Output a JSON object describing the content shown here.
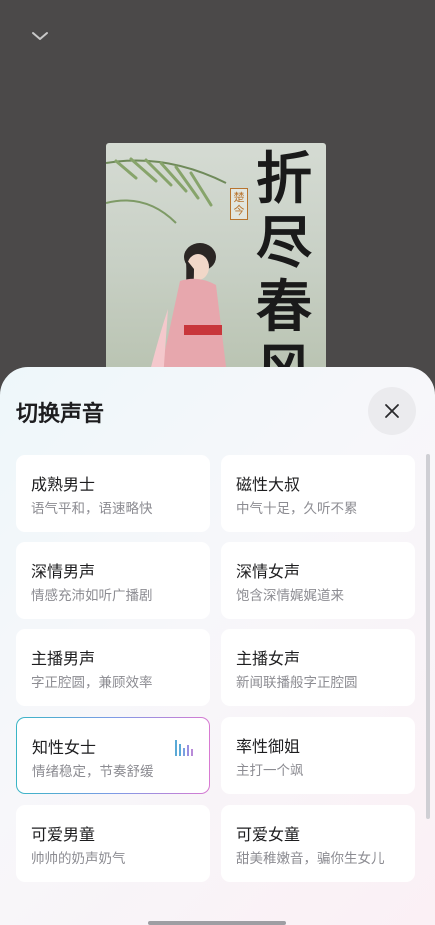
{
  "book": {
    "title": "折尽春风",
    "author": "楚今"
  },
  "sheet": {
    "title": "切换声音",
    "close_icon": "close-icon"
  },
  "voices": [
    {
      "name": "成熟男士",
      "desc": "语气平和，语速略快"
    },
    {
      "name": "磁性大叔",
      "desc": "中气十足，久听不累"
    },
    {
      "name": "深情男声",
      "desc": "情感充沛如听广播剧"
    },
    {
      "name": "深情女声",
      "desc": "饱含深情娓娓道来"
    },
    {
      "name": "主播男声",
      "desc": "字正腔圆，兼顾效率"
    },
    {
      "name": "主播女声",
      "desc": "新闻联播般字正腔圆"
    },
    {
      "name": "知性女士",
      "desc": "情绪稳定，节奏舒缓",
      "selected": true
    },
    {
      "name": "率性御姐",
      "desc": "主打一个飒"
    },
    {
      "name": "可爱男童",
      "desc": "帅帅的奶声奶气"
    },
    {
      "name": "可爱女童",
      "desc": "甜美稚嫩音，骗你生女儿"
    }
  ],
  "colors": {
    "selected_gradient_start": "#3ab5c6",
    "selected_gradient_end": "#d87ad2",
    "playing_icon": "#5aa9d6"
  }
}
